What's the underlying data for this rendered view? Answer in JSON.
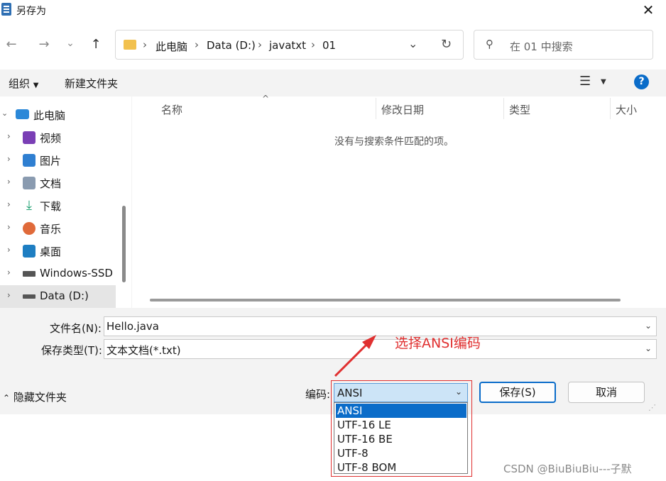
{
  "window": {
    "title": "另存为"
  },
  "nav": {
    "back": "←",
    "forward": "→",
    "recent": "⌄",
    "up": "↑",
    "breadcrumbs": [
      "此电脑",
      "Data (D:)",
      "javatxt",
      "01"
    ],
    "search_placeholder": "在 01 中搜索"
  },
  "toolbar": {
    "organize": "组织",
    "new_folder": "新建文件夹",
    "help": "?"
  },
  "tree": {
    "items": [
      {
        "label": "此电脑",
        "icon": "computer-icon",
        "color": "#2b88d8"
      },
      {
        "label": "视频",
        "icon": "video-icon",
        "color": "#7a3fb5"
      },
      {
        "label": "图片",
        "icon": "picture-icon",
        "color": "#2f7fd1"
      },
      {
        "label": "文档",
        "icon": "document-icon",
        "color": "#8a9bb0"
      },
      {
        "label": "下载",
        "icon": "download-icon",
        "color": "#1a9e6e"
      },
      {
        "label": "音乐",
        "icon": "music-icon",
        "color": "#e06a3a"
      },
      {
        "label": "桌面",
        "icon": "desktop-icon",
        "color": "#1e7ec2"
      },
      {
        "label": "Windows-SSD (",
        "icon": "drive-icon",
        "color": "#555555"
      },
      {
        "label": "Data (D:)",
        "icon": "drive-icon",
        "color": "#555555"
      }
    ]
  },
  "list": {
    "columns": [
      "名称",
      "修改日期",
      "类型",
      "大小"
    ],
    "empty_message": "没有与搜索条件匹配的项。"
  },
  "form": {
    "filename_label": "文件名(N):",
    "filename_value": "Hello.java",
    "filetype_label": "保存类型(T):",
    "filetype_value": "文本文档(*.txt)"
  },
  "bottom": {
    "hide_folders": "隐藏文件夹",
    "encoding_label": "编码:",
    "encoding_value": "ANSI",
    "save": "保存(S)",
    "cancel": "取消"
  },
  "encoding_options": [
    "ANSI",
    "UTF-16 LE",
    "UTF-16 BE",
    "UTF-8",
    "UTF-8 BOM"
  ],
  "annotation": "选择ANSI编码",
  "watermark": "CSDN @BiuBiuBiu---子默",
  "colors": {
    "accent": "#0a6cc9",
    "annotation": "#e03030",
    "folder": "#f2c14e"
  }
}
